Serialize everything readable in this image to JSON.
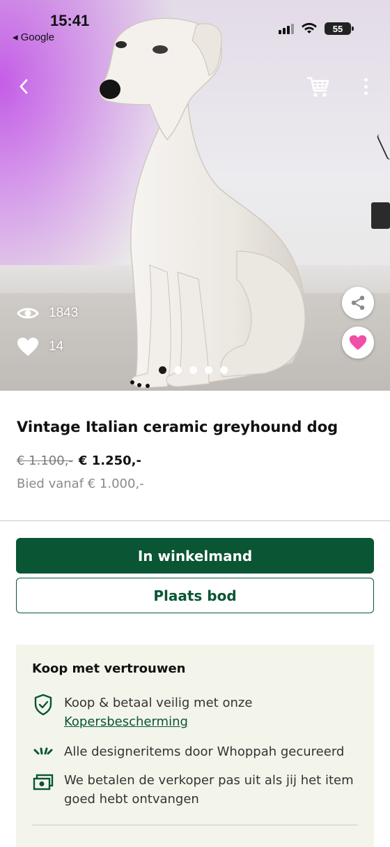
{
  "status_bar": {
    "time": "15:41",
    "back_app": "◂ Google",
    "battery": "55"
  },
  "product": {
    "title": "Vintage Italian ceramic greyhound dog",
    "old_price": "€ 1.100,-",
    "price": "€ 1.250,-",
    "bid_from": "Bied vanaf € 1.000,-",
    "views": "1843",
    "likes": "14",
    "image_count": 5,
    "active_image_index": 0
  },
  "actions": {
    "add_to_cart": "In winkelmand",
    "place_bid": "Plaats bod"
  },
  "trust": {
    "title": "Koop met vertrouwen",
    "item1_text": "Koop & betaal veilig met onze",
    "item1_link": "Kopersbescherming",
    "item2_text": "Alle designeritems door Whoppah gecureerd",
    "item3_text": "We betalen de verkoper pas uit als jij het item goed hebt ontvangen"
  },
  "icons": {
    "back": "chevron-left-icon",
    "cart": "cart-icon",
    "more": "more-vertical-icon",
    "views": "eye-icon",
    "likes": "heart-icon",
    "share": "share-icon",
    "favorite": "heart-icon",
    "protection": "shield-check-icon",
    "curated": "sparkle-icon",
    "payout": "money-icon"
  },
  "colors": {
    "brand_green": "#0a5533",
    "favorite_pink": "#ef4fa6",
    "trust_background": "#f3f5ea"
  }
}
